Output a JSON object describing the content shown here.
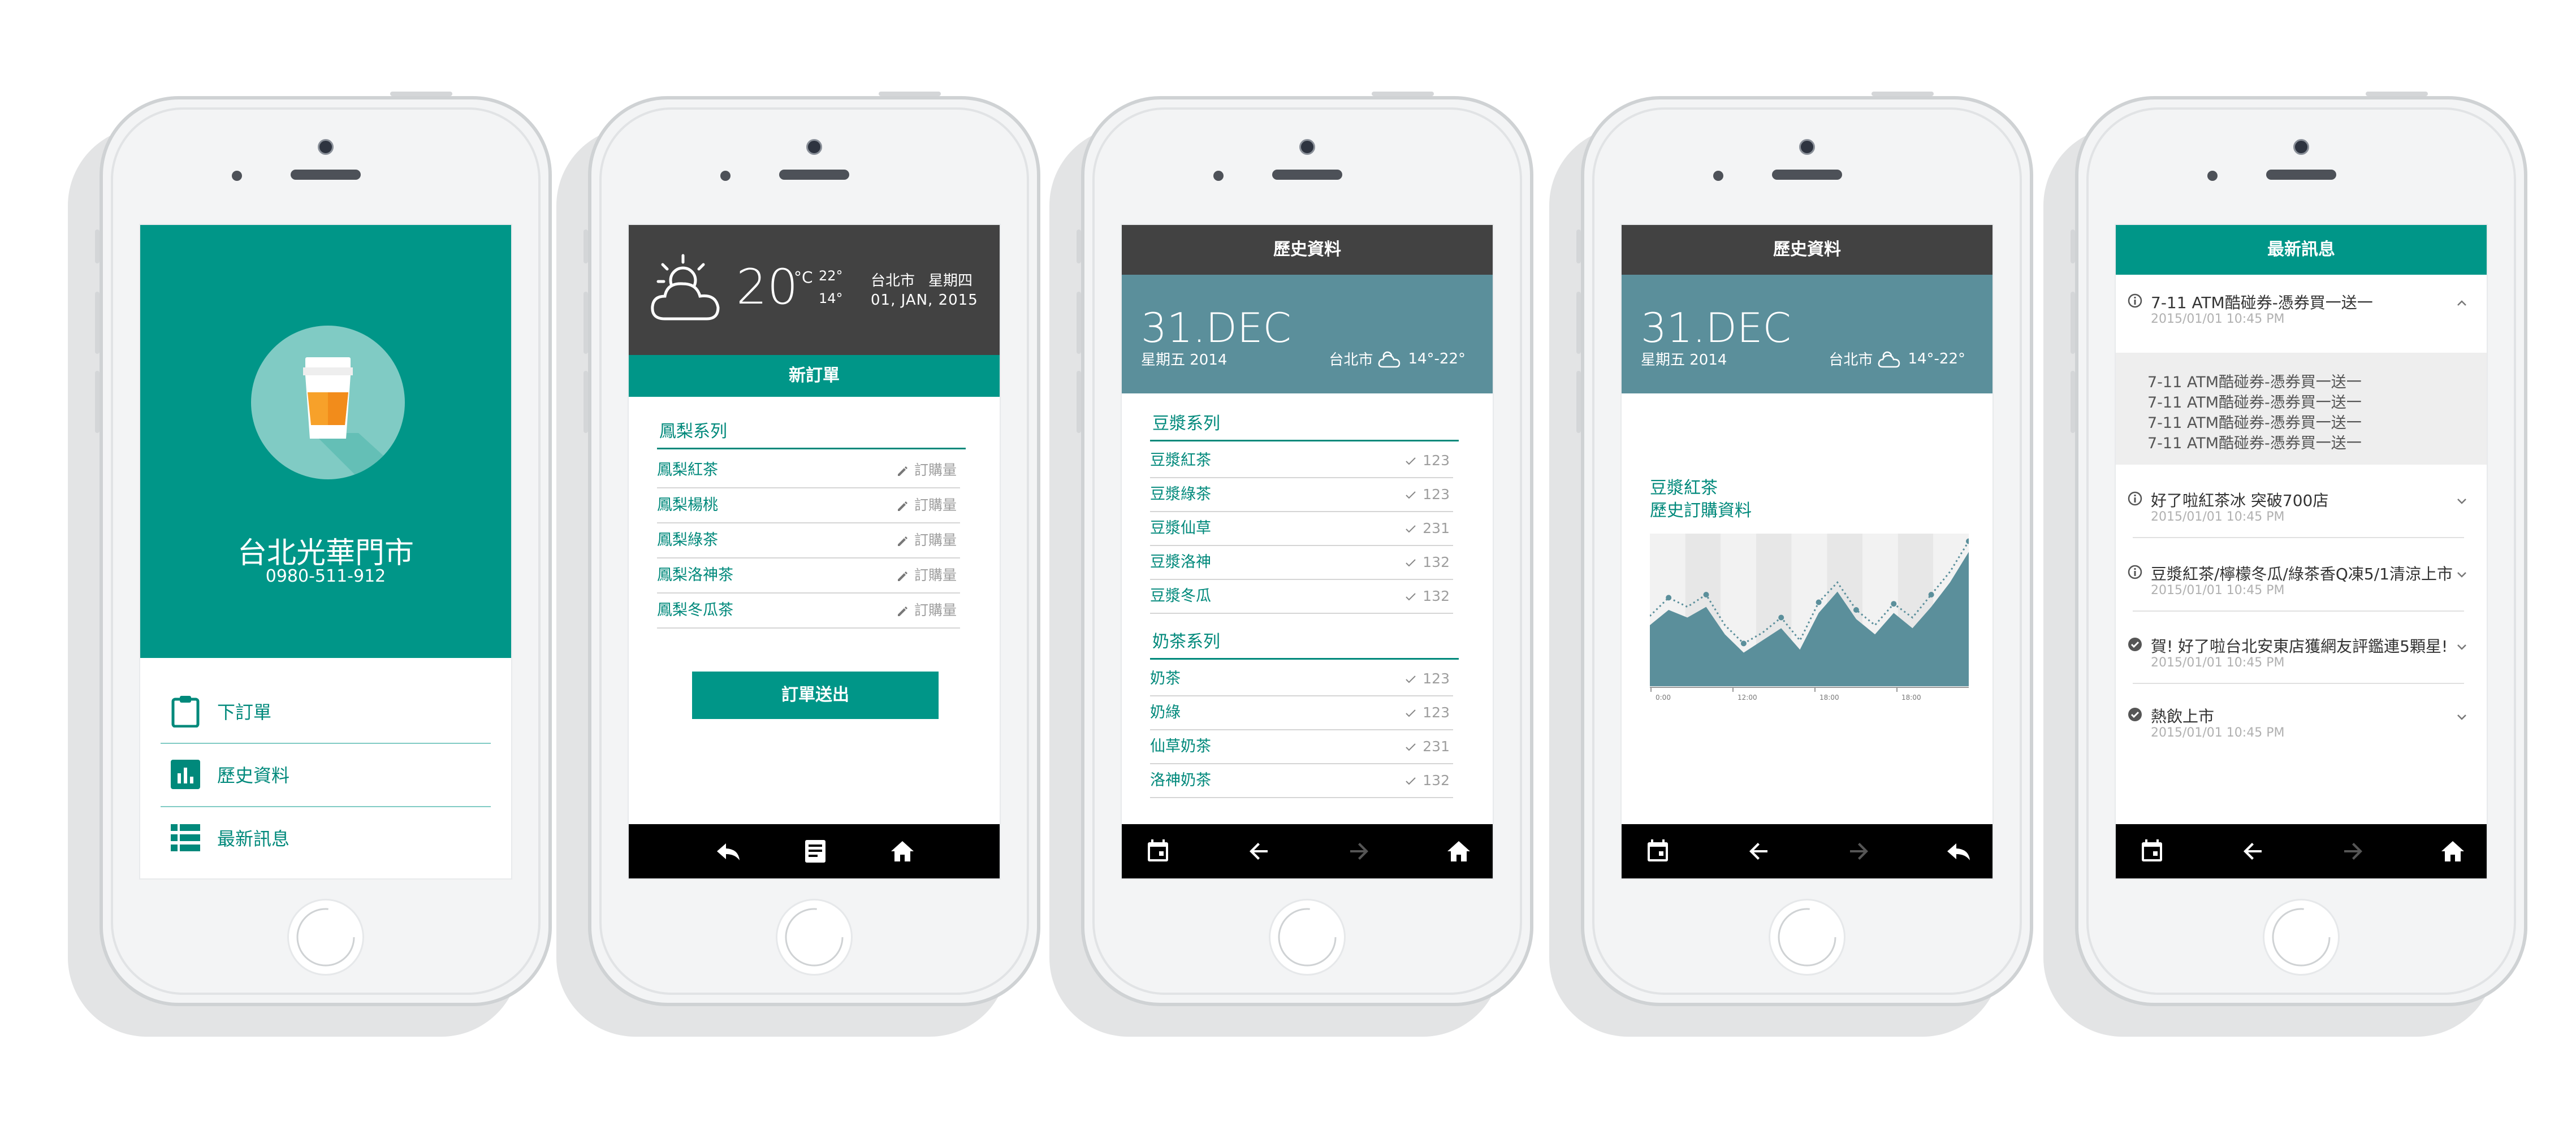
{
  "colors": {
    "teal": "#009688",
    "dark": "#424242",
    "slate": "#5b8f9b",
    "black": "#000000"
  },
  "phone1": {
    "store_name": "台北光華門市",
    "store_phone": "0980-511-912",
    "menu": [
      {
        "icon": "clipboard-icon",
        "label": "下訂單"
      },
      {
        "icon": "bar-chart-icon",
        "label": "歷史資料"
      },
      {
        "icon": "list-icon",
        "label": "最新訊息"
      }
    ]
  },
  "phone2": {
    "weather": {
      "icon": "partly-cloudy-icon",
      "temp": "20",
      "unit": "°C",
      "high": "22°",
      "low": "14°",
      "city": "台北市",
      "weekday": "星期四",
      "date": "01, JAN, 2015"
    },
    "title": "新訂單",
    "section": "鳳梨系列",
    "items": [
      {
        "name": "鳳梨紅茶",
        "action": "訂購量"
      },
      {
        "name": "鳳梨楊桃",
        "action": "訂購量"
      },
      {
        "name": "鳳梨綠茶",
        "action": "訂購量"
      },
      {
        "name": "鳳梨洛神茶",
        "action": "訂購量"
      },
      {
        "name": "鳳梨冬瓜茶",
        "action": "訂購量"
      }
    ],
    "submit": "訂單送出",
    "nav": [
      "reply-icon",
      "article-icon",
      "home-icon"
    ]
  },
  "phone3": {
    "title": "歷史資料",
    "date": "31.DEC",
    "weekday": "星期五 2014",
    "city": "台北市",
    "temp": "14°-22°",
    "sections": [
      {
        "name": "豆漿系列",
        "items": [
          {
            "name": "豆漿紅茶",
            "qty": "123"
          },
          {
            "name": "豆漿綠茶",
            "qty": "123"
          },
          {
            "name": "豆漿仙草",
            "qty": "231"
          },
          {
            "name": "豆漿洛神",
            "qty": "132"
          },
          {
            "name": "豆漿冬瓜",
            "qty": "132"
          }
        ]
      },
      {
        "name": "奶茶系列",
        "items": [
          {
            "name": "奶茶",
            "qty": "123"
          },
          {
            "name": "奶綠",
            "qty": "123"
          },
          {
            "name": "仙草奶茶",
            "qty": "231"
          },
          {
            "name": "洛神奶茶",
            "qty": "132"
          }
        ]
      }
    ],
    "nav": [
      "calendar-icon",
      "arrow-back-icon",
      "arrow-forward-icon",
      "home-icon"
    ]
  },
  "phone4": {
    "title": "歷史資料",
    "date": "31.DEC",
    "weekday": "星期五 2014",
    "city": "台北市",
    "temp": "14°-22°",
    "chart_title_1": "豆漿紅茶",
    "chart_title_2": "歷史訂購資料",
    "chart_data": {
      "type": "area",
      "series": [
        {
          "values": [
            46,
            58,
            52,
            60,
            40,
            28,
            35,
            45,
            30,
            55,
            68,
            50,
            40,
            54,
            45,
            60,
            75,
            95
          ]
        },
        {
          "values": [
            40,
            50,
            45,
            52,
            34,
            22,
            30,
            38,
            24,
            48,
            62,
            44,
            34,
            48,
            38,
            52,
            68,
            88
          ]
        }
      ],
      "x_ticks": [
        "0:00",
        "12:00",
        "18:00",
        "18:00"
      ],
      "ylim": [
        0,
        100
      ]
    },
    "nav": [
      "calendar-icon",
      "arrow-back-icon",
      "arrow-forward-icon",
      "reply-icon"
    ]
  },
  "phone5": {
    "title": "最新訊息",
    "news": [
      {
        "icon": "info-icon",
        "title": "7-11 ATM酷碰券-憑券買一送一",
        "date": "2015/01/01 10:45 PM",
        "expanded": true,
        "body": [
          "7-11 ATM酷碰券-憑券買一送一",
          "7-11 ATM酷碰券-憑券買一送一",
          "7-11 ATM酷碰券-憑券買一送一",
          "7-11 ATM酷碰券-憑券買一送一"
        ]
      },
      {
        "icon": "info-icon",
        "title": "好了啦紅茶冰 突破700店",
        "date": "2015/01/01 10:45 PM"
      },
      {
        "icon": "info-icon",
        "title": "豆漿紅茶/檸檬冬瓜/綠茶香Q凍5/1清涼上市",
        "date": "2015/01/01 10:45 PM"
      },
      {
        "icon": "check-circle-icon",
        "title": "賀! 好了啦台北安東店獲網友評鑑連5顆星!",
        "date": "2015/01/01 10:45 PM"
      },
      {
        "icon": "check-circle-icon",
        "title": "熱飲上市",
        "date": "2015/01/01 10:45 PM"
      }
    ],
    "nav": [
      "calendar-icon",
      "arrow-back-icon",
      "arrow-forward-icon",
      "home-icon"
    ]
  }
}
